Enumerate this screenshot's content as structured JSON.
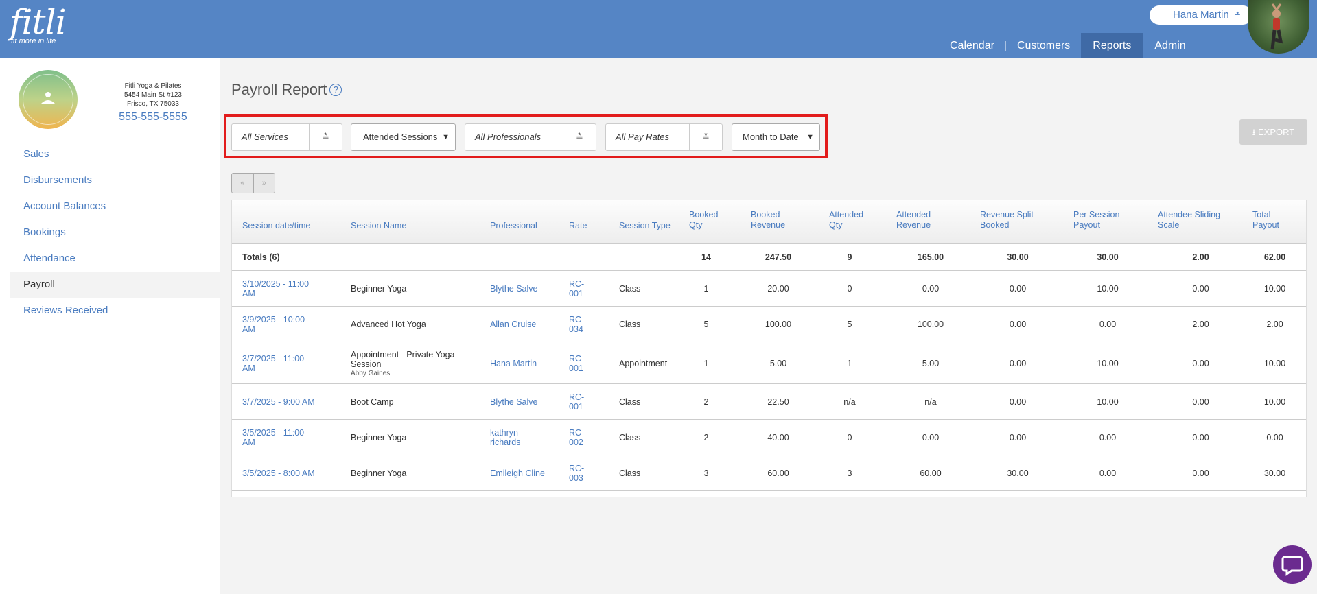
{
  "brand": {
    "name": "fitli",
    "tagline": "fit more in life"
  },
  "user": {
    "name": "Hana Martin"
  },
  "nav": [
    {
      "label": "Calendar",
      "active": false
    },
    {
      "label": "Customers",
      "active": false
    },
    {
      "label": "Reports",
      "active": true
    },
    {
      "label": "Admin",
      "active": false
    }
  ],
  "studio": {
    "name": "Fitli Yoga & Pilates",
    "address1": "5454 Main St #123",
    "address2": "Frisco, TX 75033",
    "phone": "555-555-5555"
  },
  "sidebar": [
    {
      "label": "Sales"
    },
    {
      "label": "Disbursements"
    },
    {
      "label": "Account Balances"
    },
    {
      "label": "Bookings"
    },
    {
      "label": "Attendance"
    },
    {
      "label": "Payroll",
      "active": true
    },
    {
      "label": "Reviews Received"
    }
  ],
  "page": {
    "title": "Payroll Report",
    "help": "?"
  },
  "filters": {
    "services": "All Services",
    "sessions": "Attended Sessions",
    "professionals": "All Professionals",
    "pay_rates": "All Pay Rates",
    "period": "Month to Date"
  },
  "export_label": "EXPORT",
  "pager": {
    "prev": "«",
    "next": "»"
  },
  "table": {
    "headers": {
      "date": "Session date/time",
      "name": "Session Name",
      "professional": "Professional",
      "rate": "Rate",
      "type": "Session Type",
      "booked_qty": [
        "Booked",
        "Qty"
      ],
      "booked_rev": [
        "Booked",
        "Revenue"
      ],
      "att_qty": [
        "Attended",
        "Qty"
      ],
      "att_rev": [
        "Attended",
        "Revenue"
      ],
      "split": [
        "Revenue Split",
        "Booked"
      ],
      "per_session": [
        "Per Session",
        "Payout"
      ],
      "sliding": [
        "Attendee Sliding",
        "Scale"
      ],
      "total": [
        "Total",
        "Payout"
      ]
    },
    "totals": {
      "label": "Totals (6)",
      "booked_qty": "14",
      "booked_rev": "247.50",
      "att_qty": "9",
      "att_rev": "165.00",
      "split": "30.00",
      "per_session": "30.00",
      "sliding": "2.00",
      "total": "62.00"
    },
    "rows": [
      {
        "date": [
          "3/10/2025 - 11:00",
          "AM"
        ],
        "name": [
          "Beginner Yoga"
        ],
        "sub": "",
        "professional": [
          "Blythe Salve"
        ],
        "rate": [
          "RC-",
          "001"
        ],
        "type": "Class",
        "booked_qty": "1",
        "booked_rev": "20.00",
        "att_qty": "0",
        "att_rev": "0.00",
        "split": "0.00",
        "per_session": "10.00",
        "sliding": "0.00",
        "total": "10.00"
      },
      {
        "date": [
          "3/9/2025 - 10:00",
          "AM"
        ],
        "name": [
          "Advanced Hot Yoga"
        ],
        "sub": "",
        "professional": [
          "Allan Cruise"
        ],
        "rate": [
          "RC-",
          "034"
        ],
        "type": "Class",
        "booked_qty": "5",
        "booked_rev": "100.00",
        "att_qty": "5",
        "att_rev": "100.00",
        "split": "0.00",
        "per_session": "0.00",
        "sliding": "2.00",
        "total": "2.00"
      },
      {
        "date": [
          "3/7/2025 - 11:00",
          "AM"
        ],
        "name": [
          "Appointment - Private Yoga",
          "Session"
        ],
        "sub": "Abby Gaines",
        "professional": [
          "Hana Martin"
        ],
        "rate": [
          "RC-",
          "001"
        ],
        "type": "Appointment",
        "booked_qty": "1",
        "booked_rev": "5.00",
        "att_qty": "1",
        "att_rev": "5.00",
        "split": "0.00",
        "per_session": "10.00",
        "sliding": "0.00",
        "total": "10.00"
      },
      {
        "date": [
          "3/7/2025 - 9:00 AM"
        ],
        "name": [
          "Boot Camp"
        ],
        "sub": "",
        "professional": [
          "Blythe Salve"
        ],
        "rate": [
          "RC-",
          "001"
        ],
        "type": "Class",
        "booked_qty": "2",
        "booked_rev": "22.50",
        "att_qty": "n/a",
        "att_rev": "n/a",
        "split": "0.00",
        "per_session": "10.00",
        "sliding": "0.00",
        "total": "10.00"
      },
      {
        "date": [
          "3/5/2025 - 11:00",
          "AM"
        ],
        "name": [
          "Beginner Yoga"
        ],
        "sub": "",
        "professional": [
          "kathryn",
          "richards"
        ],
        "rate": [
          "RC-",
          "002"
        ],
        "type": "Class",
        "booked_qty": "2",
        "booked_rev": "40.00",
        "att_qty": "0",
        "att_rev": "0.00",
        "split": "0.00",
        "per_session": "0.00",
        "sliding": "0.00",
        "total": "0.00"
      },
      {
        "date": [
          "3/5/2025 - 8:00 AM"
        ],
        "name": [
          "Beginner Yoga"
        ],
        "sub": "",
        "professional": [
          "Emileigh Cline"
        ],
        "rate": [
          "RC-",
          "003"
        ],
        "type": "Class",
        "booked_qty": "3",
        "booked_rev": "60.00",
        "att_qty": "3",
        "att_rev": "60.00",
        "split": "30.00",
        "per_session": "0.00",
        "sliding": "0.00",
        "total": "30.00"
      }
    ]
  }
}
